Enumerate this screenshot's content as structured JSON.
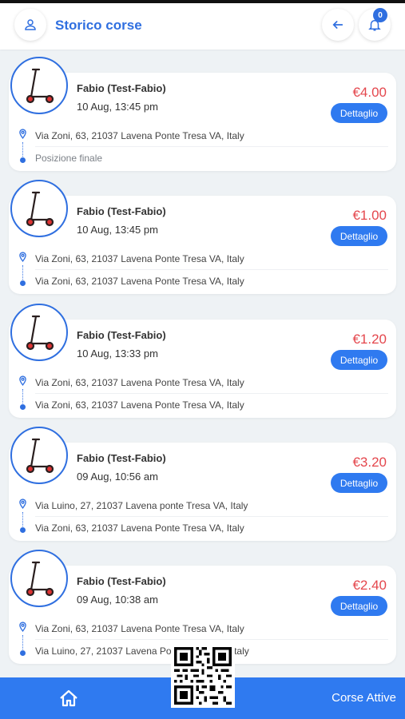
{
  "header": {
    "title": "Storico corse",
    "notification_count": "0"
  },
  "rides": [
    {
      "user": "Fabio (Test-Fabio)",
      "date": "10 Aug, 13:45 pm",
      "price": "€4.00",
      "button": "Dettaglio",
      "start": "Via Zoni, 63, 21037 Lavena Ponte Tresa VA, Italy",
      "end": "Posizione finale",
      "end_muted": true
    },
    {
      "user": "Fabio (Test-Fabio)",
      "date": "10 Aug, 13:45 pm",
      "price": "€1.00",
      "button": "Dettaglio",
      "start": "Via Zoni, 63, 21037 Lavena Ponte Tresa VA, Italy",
      "end": "Via Zoni, 63, 21037 Lavena Ponte Tresa VA, Italy",
      "end_muted": false
    },
    {
      "user": "Fabio (Test-Fabio)",
      "date": "10 Aug, 13:33 pm",
      "price": "€1.20",
      "button": "Dettaglio",
      "start": "Via Zoni, 63, 21037 Lavena Ponte Tresa VA, Italy",
      "end": "Via Zoni, 63, 21037 Lavena Ponte Tresa VA, Italy",
      "end_muted": false
    },
    {
      "user": "Fabio (Test-Fabio)",
      "date": "09 Aug, 10:56 am",
      "price": "€3.20",
      "button": "Dettaglio",
      "start": "Via Luino, 27, 21037 Lavena ponte Tresa VA, Italy",
      "end": "Via Zoni, 63, 21037 Lavena Ponte Tresa VA, Italy",
      "end_muted": false
    },
    {
      "user": "Fabio (Test-Fabio)",
      "date": "09 Aug, 10:38 am",
      "price": "€2.40",
      "button": "Dettaglio",
      "start": "Via Zoni, 63, 21037 Lavena Ponte Tresa VA, Italy",
      "end": "Via Luino, 27, 21037 Lavena Ponte Tresa VA, Italy",
      "end_muted": false
    }
  ],
  "bottom_nav": {
    "home_icon": "home-icon",
    "active_label": "Corse Attive"
  },
  "colors": {
    "accent": "#2f7af0",
    "price": "#e4474d",
    "background": "#eef2f5"
  }
}
